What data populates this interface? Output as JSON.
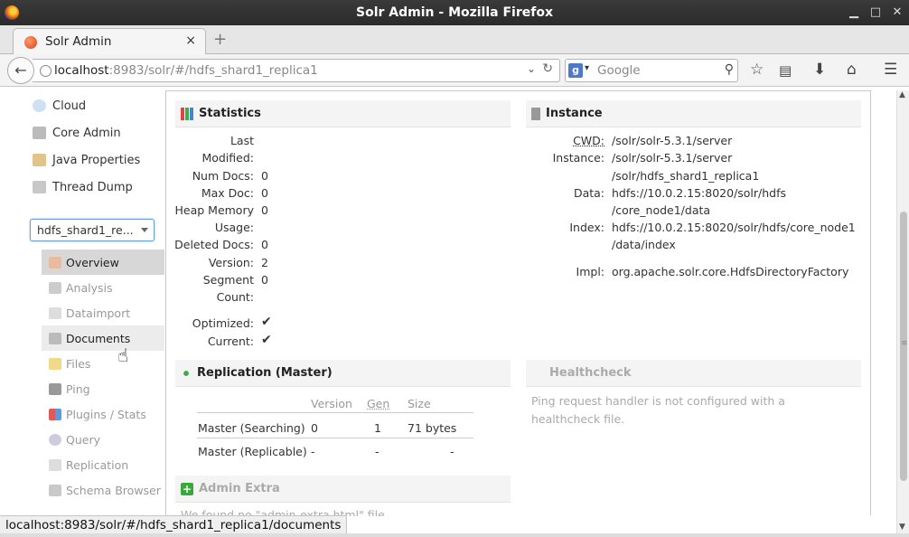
{
  "window": {
    "title": "Solr Admin - Mozilla Firefox"
  },
  "tab": {
    "title": "Solr Admin",
    "close": "×",
    "new": "+"
  },
  "nav": {
    "url_host": "localhost",
    "url_rest": ":8983/solr/#/hdfs_shard1_replica1",
    "search_placeholder": "Google"
  },
  "sidebar": {
    "items": [
      {
        "label": "Cloud",
        "icon": "cloud-icon"
      },
      {
        "label": "Core Admin",
        "icon": "core-admin-icon"
      },
      {
        "label": "Java Properties",
        "icon": "java-icon"
      },
      {
        "label": "Thread Dump",
        "icon": "thread-dump-icon"
      }
    ],
    "core_selector": "hdfs_shard1_re...",
    "core_menu": [
      {
        "label": "Overview",
        "state": "active"
      },
      {
        "label": "Analysis",
        "state": "disabled"
      },
      {
        "label": "Dataimport",
        "state": "disabled"
      },
      {
        "label": "Documents",
        "state": "hover"
      },
      {
        "label": "Files",
        "state": "disabled"
      },
      {
        "label": "Ping",
        "state": "disabled"
      },
      {
        "label": "Plugins / Stats",
        "state": "disabled"
      },
      {
        "label": "Query",
        "state": "disabled"
      },
      {
        "label": "Replication",
        "state": "disabled"
      },
      {
        "label": "Schema Browser",
        "state": "disabled"
      }
    ]
  },
  "statistics": {
    "title": "Statistics",
    "last_modified_k1": "Last",
    "last_modified_k2": "Modified:",
    "num_docs_k": "Num Docs:",
    "num_docs_v": "0",
    "max_doc_k": "Max Doc:",
    "max_doc_v": "0",
    "heap_k1": "Heap Memory",
    "heap_v": "0",
    "heap_k2": "Usage:",
    "deleted_k": "Deleted Docs:",
    "deleted_v": "0",
    "version_k": "Version:",
    "version_v": "2",
    "segment_k1": "Segment",
    "segment_v": "0",
    "segment_k2": "Count:",
    "optimized_k": "Optimized:",
    "current_k": "Current:",
    "check": "✔"
  },
  "instance": {
    "title": "Instance",
    "cwd_k": "CWD:",
    "cwd_v": "/solr/solr-5.3.1/server",
    "instance_k": "Instance:",
    "instance_v1": "/solr/solr-5.3.1/server",
    "instance_v2": "/solr/hdfs_shard1_replica1",
    "data_k": "Data:",
    "data_v1": "hdfs://10.0.2.15:8020/solr/hdfs",
    "data_v2": "/core_node1/data",
    "index_k": "Index:",
    "index_v1": "hdfs://10.0.2.15:8020/solr/hdfs/core_node1",
    "index_v2": "/data/index",
    "impl_k": "Impl:",
    "impl_v": "org.apache.solr.core.HdfsDirectoryFactory"
  },
  "replication": {
    "title": "Replication (Master)",
    "headers": [
      "Version",
      "Gen",
      "Size"
    ],
    "rows": [
      {
        "label": "Master (Searching)",
        "version": "0",
        "gen": "1",
        "size": "71 bytes"
      },
      {
        "label": "Master (Replicable)",
        "version": "-",
        "gen": "-",
        "size": "-"
      }
    ]
  },
  "healthcheck": {
    "title": "Healthcheck",
    "message": "Ping request handler is not configured with a healthcheck file."
  },
  "admin_extra": {
    "title": "Admin Extra",
    "note": "We found no \"admin-extra.html\" file."
  },
  "status": {
    "text": "localhost:8983/solr/#/hdfs_shard1_replica1/documents"
  }
}
